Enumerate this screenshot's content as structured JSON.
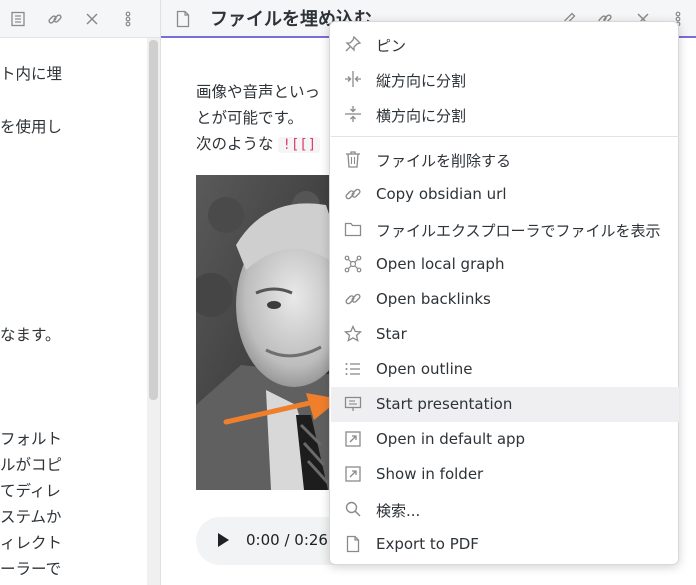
{
  "left_pane": {
    "header_icons": [
      "document-lines-icon",
      "link-icon",
      "close-icon",
      "more-vertical-icon"
    ],
    "text_lines": [
      "ト内に埋",
      "を使用し",
      "なます。",
      "フォルト",
      "ルがコピ",
      "てディレ",
      "ステムか",
      "ィレクト",
      "ーラーで"
    ]
  },
  "right_pane": {
    "tab_title": "ファイルを埋め込む",
    "header_icons": [
      "edit-icon",
      "link-icon",
      "close-icon",
      "more-vertical-icon"
    ],
    "paragraph_line1": "画像や音声といっ",
    "paragraph_line2": "とが可能です。",
    "paragraph_line3": "次のような",
    "inline_code": "![[]",
    "audio_time": "0:00 / 0:26"
  },
  "context_menu": {
    "items": [
      {
        "label": "ピン",
        "icon": "pin-icon"
      },
      {
        "label": "縦方向に分割",
        "icon": "split-vertical-icon"
      },
      {
        "label": "横方向に分割",
        "icon": "split-horizontal-icon"
      },
      {
        "label": "ファイルを削除する",
        "icon": "trash-icon"
      },
      {
        "label": "Copy obsidian url",
        "icon": "link-icon"
      },
      {
        "label": "ファイルエクスプローラでファイルを表示",
        "icon": "folder-icon"
      },
      {
        "label": "Open local graph",
        "icon": "graph-icon"
      },
      {
        "label": "Open backlinks",
        "icon": "link-icon"
      },
      {
        "label": "Star",
        "icon": "star-icon"
      },
      {
        "label": "Open outline",
        "icon": "list-icon"
      },
      {
        "label": "Start presentation",
        "icon": "presentation-icon"
      },
      {
        "label": "Open in default app",
        "icon": "external-link-icon"
      },
      {
        "label": "Show in folder",
        "icon": "external-link-icon"
      },
      {
        "label": "検索...",
        "icon": "search-icon"
      },
      {
        "label": "Export to PDF",
        "icon": "document-icon"
      }
    ],
    "highlighted_item": "Start presentation"
  },
  "colors": {
    "accent": "#7b6cd9",
    "arrow": "#f07f2c",
    "highlight": "#efeff1",
    "code_text": "#e03e6b"
  }
}
